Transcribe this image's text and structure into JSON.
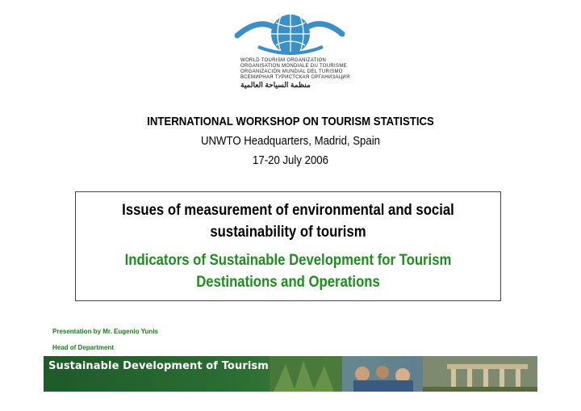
{
  "organization": {
    "lines": [
      "WORLD TOURISM ORGANIZATION",
      "ORGANISATION MONDIALE DU TOURISME",
      "ORGANIZACIÓN MUNDIAL DEL TURISMO",
      "ВСЕМИРНАЯ ТУРИСТСКАЯ ОРГАНИЗАЦИЯ"
    ],
    "arabic": "منظمة السياحة العالمية"
  },
  "workshop": {
    "title": "INTERNATIONAL WORKSHOP ON TOURISM STATISTICS",
    "venue": "UNWTO Headquarters, Madrid, Spain",
    "date": "17-20 July 2006"
  },
  "topic": {
    "title_line1": "Issues of measurement of environmental and social",
    "title_line2": "sustainability of tourism",
    "subtitle_line1": "Indicators of Sustainable Development for Tourism",
    "subtitle_line2": "Destinations and Operations"
  },
  "presenter": {
    "line1": "Presentation by Mr. Eugenio Yunis",
    "line2": "Head of Department"
  },
  "banner": {
    "text": "Sustainable Development of Tourism"
  },
  "colors": {
    "accent_green": "#1e8c1e",
    "logo_blue": "#3b8fc4",
    "banner_green": "#2c6e34"
  }
}
